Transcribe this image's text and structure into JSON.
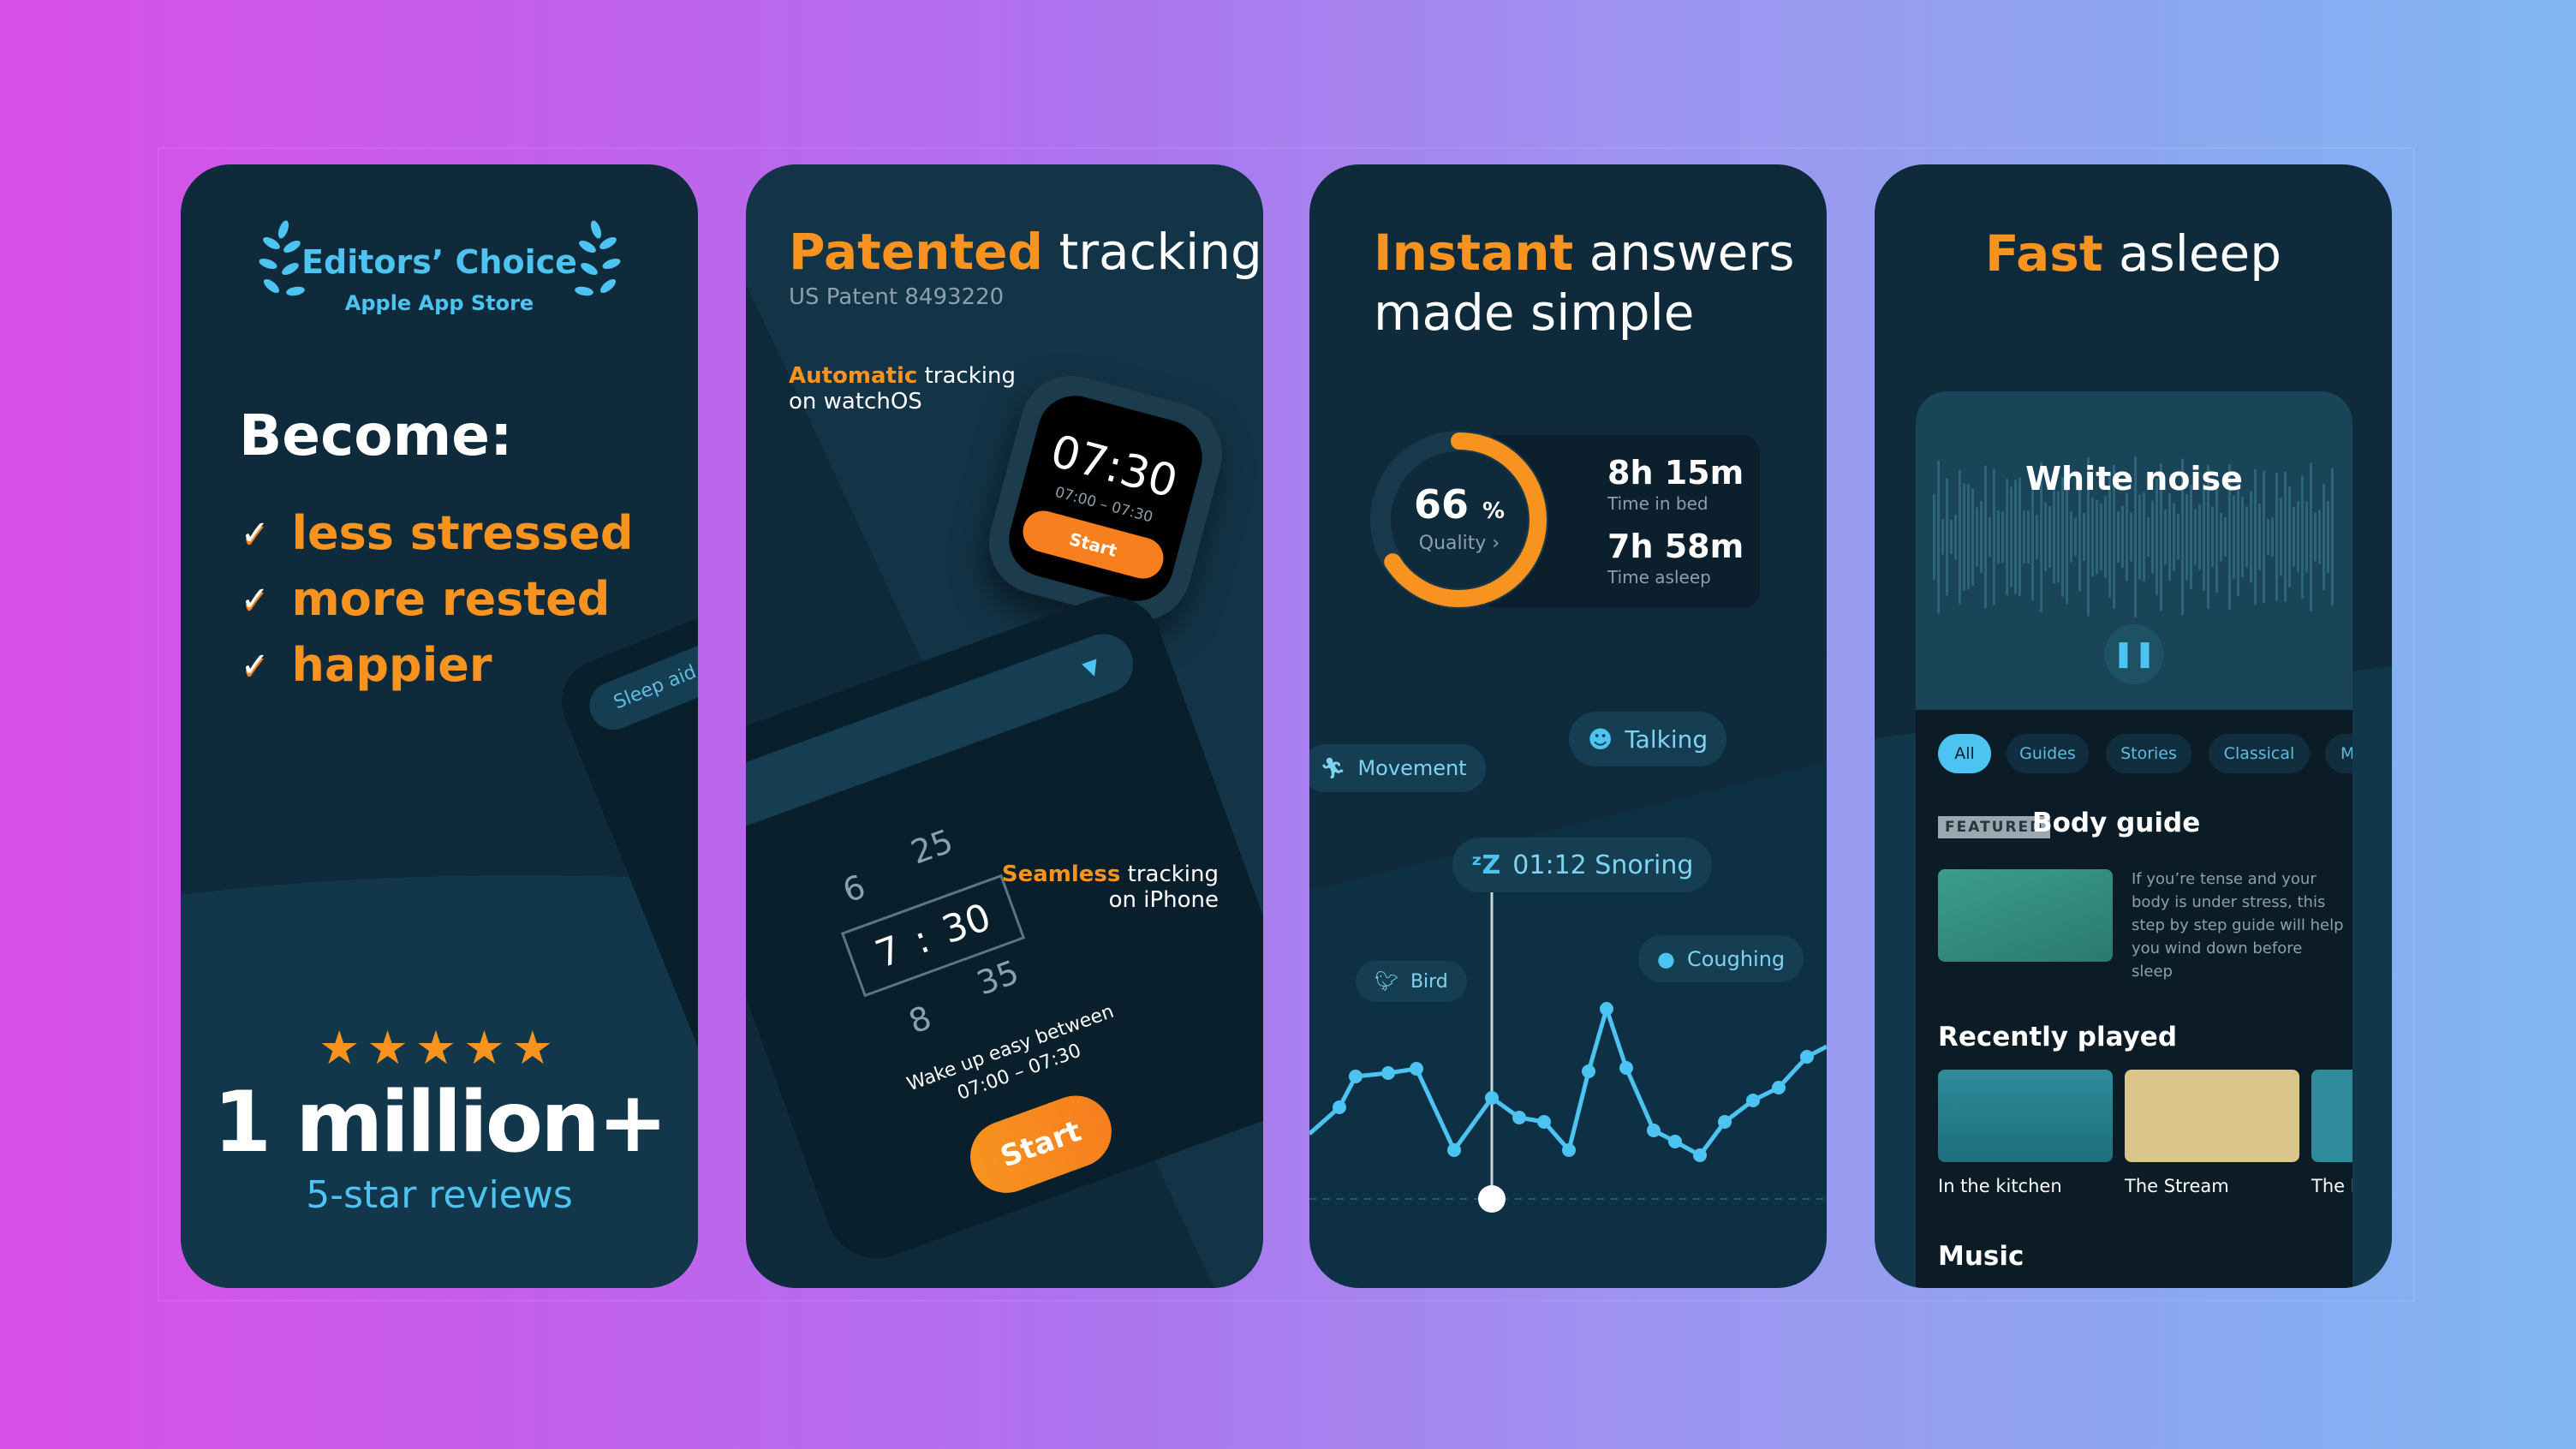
{
  "colors": {
    "accent_orange": "#f7931e",
    "accent_blue": "#4cc3f0",
    "card_bg": "#0f2a3a"
  },
  "card1": {
    "badge_title": "Editors’ Choice",
    "badge_subtitle": "Apple App Store",
    "heading": "Become:",
    "benefits": [
      "less stressed",
      "more rested",
      "happier"
    ],
    "phone_tab": "Sleep aid",
    "rating_stars": 5,
    "reviews_count": "1 million+",
    "reviews_label": "5-star reviews"
  },
  "card2": {
    "title_highlight": "Patented",
    "title_rest": "tracking",
    "patent": "US Patent 8493220",
    "watch_caption_highlight": "Automatic",
    "watch_caption_rest": "tracking",
    "watch_caption_line2": "on watchOS",
    "watch_time": "07:30",
    "watch_range": "07:00 – 07:30",
    "watch_start": "Start",
    "phone_picker": {
      "above_hour": "6",
      "above_min": "25",
      "hour": "7",
      "min": "30",
      "below_hour": "8",
      "below_min": "35"
    },
    "phone_caption_line1": "Wake up easy between",
    "phone_caption_line2": "07:00 – 07:30",
    "phone_start": "Start",
    "iphone_caption_highlight": "Seamless",
    "iphone_caption_rest": "tracking",
    "iphone_caption_line2": "on iPhone"
  },
  "card3": {
    "title_highlight": "Instant",
    "title_rest": "answers",
    "title_line2": "made simple",
    "quality_value": "66",
    "quality_unit": "%",
    "quality_label": "Quality",
    "quality_percent": 66,
    "time_in_bed": "8h 15m",
    "time_in_bed_label": "Time in bed",
    "time_asleep": "7h 58m",
    "time_asleep_label": "Time asleep",
    "events": {
      "talking": "Talking",
      "movement": "Movement",
      "snoring": "01:12 Snoring",
      "bird": "Bird",
      "coughing": "Coughing"
    }
  },
  "card4": {
    "title_highlight": "Fast",
    "title_rest": "asleep",
    "player_title": "White noise",
    "filters": [
      "All",
      "Guides",
      "Stories",
      "Classical",
      "Mu"
    ],
    "active_filter": "All",
    "featured_badge": "FEATURED",
    "featured_title": "Body guide",
    "featured_description": "If you’re tense and your body is under stress, this step by step guide will help you wind down before sleep",
    "recent_heading": "Recently played",
    "recent_items": [
      "In the kitchen",
      "The Stream",
      "The F"
    ],
    "music_heading": "Music"
  }
}
